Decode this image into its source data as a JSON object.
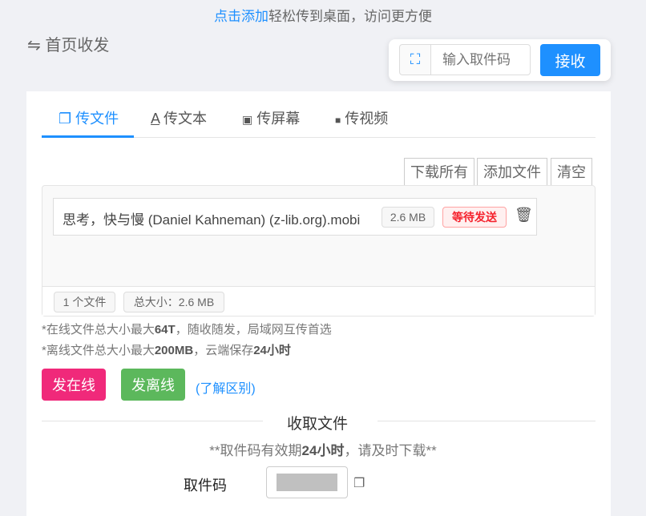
{
  "banner": {
    "link": "点击添加",
    "text": "轻松传到桌面，访问更方便"
  },
  "header": {
    "icon": "swap-icon",
    "title": "首页收发"
  },
  "receive_bar": {
    "placeholder": "输入取件码",
    "button": "接收"
  },
  "tabs": [
    {
      "label": "传文件",
      "icon": "file-icon"
    },
    {
      "label": "传文本",
      "icon": "text-icon"
    },
    {
      "label": "传屏幕",
      "icon": "screen-icon"
    },
    {
      "label": "传视频",
      "icon": "video-icon"
    }
  ],
  "toolbar": {
    "download_all": "下载所有",
    "add_file": "添加文件",
    "clear": "清空"
  },
  "files": [
    {
      "name": "思考，快与慢 (Daniel Kahneman) (z-lib.org).mobi",
      "size": "2.6 MB",
      "status": "等待发送"
    }
  ],
  "summary": {
    "count": "1 个文件",
    "total": "总大小：2.6 MB"
  },
  "notes": {
    "n1a": "*在线文件总大小最大",
    "n1b": "64T",
    "n1c": "，随收随发，局域网互传首选",
    "n2a": "*离线文件总大小最大",
    "n2b": "200MB",
    "n2c": "，云端保存",
    "n2d": "24小时"
  },
  "actions": {
    "online": "发在线",
    "offline": "发离线",
    "diff": "(了解区别)"
  },
  "receive": {
    "title": "收取文件",
    "note_a": "**取件码有效期",
    "note_b": "24小时",
    "note_c": "，请及时下载**",
    "code_label": "取件码"
  },
  "colors": {
    "accent": "#1e90ff",
    "online": "#f0297a",
    "offline": "#5cb85c",
    "pending": "#f5222d"
  }
}
